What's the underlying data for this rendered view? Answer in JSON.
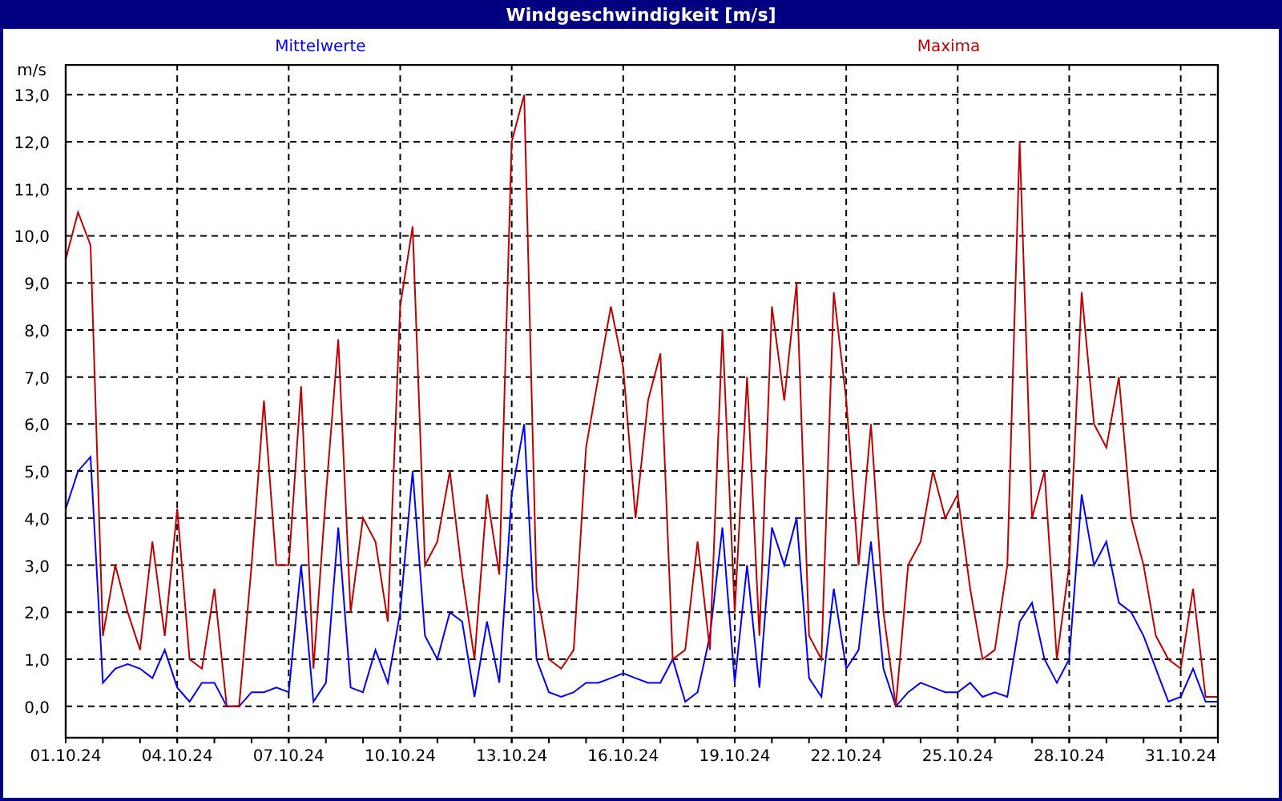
{
  "chart": {
    "chart_data": {
      "type": "line",
      "title": "Windgeschwindigkeit [m/s]",
      "ylabel": "m/s",
      "categories": [
        "01.10.24",
        null,
        null,
        null,
        null,
        null,
        null,
        null,
        null,
        "04.10.24",
        null,
        null,
        null,
        null,
        null,
        null,
        null,
        null,
        "07.10.24",
        null,
        null,
        null,
        null,
        null,
        null,
        null,
        null,
        "10.10.24",
        null,
        null,
        null,
        null,
        null,
        null,
        null,
        null,
        "13.10.24",
        null,
        null,
        null,
        null,
        null,
        null,
        null,
        null,
        "16.10.24",
        null,
        null,
        null,
        null,
        null,
        null,
        null,
        null,
        "19.10.24",
        null,
        null,
        null,
        null,
        null,
        null,
        null,
        null,
        "22.10.24",
        null,
        null,
        null,
        null,
        null,
        null,
        null,
        null,
        "25.10.24",
        null,
        null,
        null,
        null,
        null,
        null,
        null,
        null,
        "28.10.24",
        null,
        null,
        null,
        null,
        null,
        null,
        null,
        null,
        "31.10.24",
        null,
        null,
        null
      ],
      "series": [
        {
          "name": "Mittelwerte",
          "color": "#0000ff",
          "values": [
            4.2,
            5.0,
            5.3,
            0.5,
            0.8,
            0.9,
            0.8,
            0.6,
            1.2,
            0.4,
            0.1,
            0.5,
            0.5,
            0.0,
            0.0,
            0.3,
            0.3,
            0.4,
            0.3,
            3.0,
            0.1,
            0.5,
            3.8,
            0.4,
            0.3,
            1.2,
            0.5,
            2.0,
            5.0,
            1.5,
            1.0,
            2.0,
            1.8,
            0.2,
            1.8,
            0.5,
            4.5,
            6.0,
            1.0,
            0.3,
            0.2,
            0.3,
            0.5,
            0.5,
            0.6,
            0.7,
            0.6,
            0.5,
            0.5,
            1.0,
            0.1,
            0.3,
            1.5,
            3.8,
            0.5,
            3.0,
            0.4,
            3.8,
            3.0,
            4.0,
            0.6,
            0.2,
            2.5,
            0.8,
            1.2,
            3.5,
            0.8,
            0.0,
            0.3,
            0.5,
            0.4,
            0.3,
            0.3,
            0.5,
            0.2,
            0.3,
            0.2,
            1.8,
            2.2,
            1.0,
            0.5,
            1.0,
            4.5,
            3.0,
            3.5,
            2.2,
            2.0,
            1.5,
            0.8,
            0.1,
            0.2,
            0.8,
            0.1,
            0.1
          ]
        },
        {
          "name": "Maxima",
          "color": "#c00000",
          "values": [
            9.5,
            10.5,
            9.8,
            1.5,
            3.0,
            2.0,
            1.2,
            3.5,
            1.5,
            4.2,
            1.0,
            0.8,
            2.5,
            0.0,
            0.0,
            3.0,
            6.5,
            3.0,
            3.0,
            6.8,
            0.8,
            4.5,
            7.8,
            2.0,
            4.0,
            3.5,
            1.8,
            8.5,
            10.2,
            3.0,
            3.5,
            5.0,
            2.8,
            1.0,
            4.5,
            2.8,
            12.0,
            13.0,
            2.5,
            1.0,
            0.8,
            1.2,
            5.5,
            7.0,
            8.5,
            7.2,
            4.0,
            6.5,
            7.5,
            1.0,
            1.2,
            3.5,
            1.2,
            8.0,
            2.0,
            7.0,
            1.5,
            8.5,
            6.5,
            9.0,
            1.5,
            1.0,
            8.8,
            6.5,
            3.0,
            6.0,
            2.0,
            0.0,
            3.0,
            3.5,
            5.0,
            4.0,
            4.5,
            2.5,
            1.0,
            1.2,
            3.0,
            12.0,
            4.0,
            5.0,
            1.0,
            3.0,
            8.8,
            6.0,
            5.5,
            7.0,
            4.0,
            3.0,
            1.5,
            1.0,
            0.8,
            2.5,
            0.2,
            0.2
          ]
        }
      ],
      "ylim": [
        -0.65,
        13.65
      ],
      "grid": true,
      "yticks": [
        {
          "value": 0,
          "label": "0,0"
        },
        {
          "value": 1,
          "label": "1,0"
        },
        {
          "value": 2,
          "label": "2,0"
        },
        {
          "value": 3,
          "label": "3,0"
        },
        {
          "value": 4,
          "label": "4,0"
        },
        {
          "value": 5,
          "label": "5,0"
        },
        {
          "value": 6,
          "label": "6,0"
        },
        {
          "value": 7,
          "label": "7,0"
        },
        {
          "value": 8,
          "label": "8,0"
        },
        {
          "value": 9,
          "label": "9,0"
        },
        {
          "value": 10,
          "label": "10,0"
        },
        {
          "value": 11,
          "label": "11,0"
        },
        {
          "value": 12,
          "label": "12,0"
        },
        {
          "value": 13,
          "label": "13,0"
        }
      ]
    }
  }
}
